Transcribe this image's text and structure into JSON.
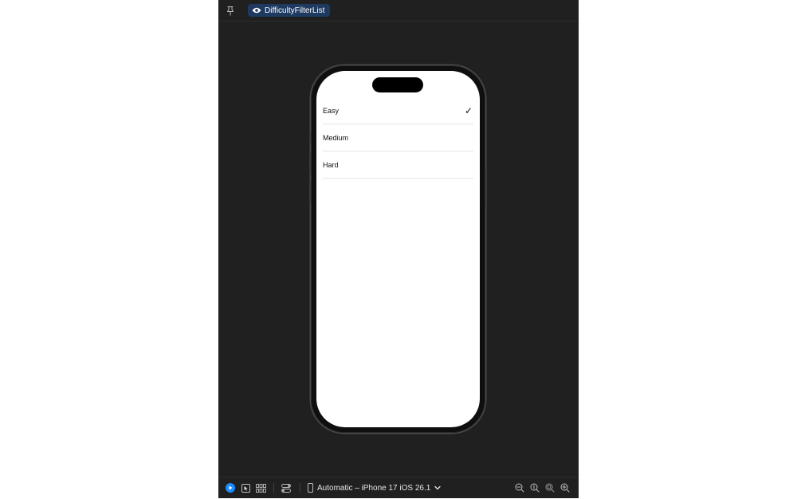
{
  "top_bar": {
    "preview_tab_label": "DifficultyFilterList"
  },
  "icons": {
    "pin": "pin-icon",
    "eye": "eye-icon",
    "play": "live-preview-icon",
    "select": "selectable-icon",
    "variants": "variants-grid-icon",
    "settings": "canvas-settings-icon",
    "device": "device-icon",
    "chevron": "chevron-down-icon",
    "zoom_out": "zoom-out-icon",
    "zoom_actual": "zoom-actual-icon",
    "zoom_fit": "zoom-fit-icon",
    "zoom_in": "zoom-in-icon"
  },
  "list": {
    "items": [
      {
        "label": "Easy",
        "checkmark": "✓"
      },
      {
        "label": "Medium"
      },
      {
        "label": "Hard"
      }
    ]
  },
  "bottom_bar": {
    "device_label": "Automatic – iPhone 17 iOS 26.1"
  },
  "colors": {
    "canvas": "#202020",
    "accent": "#1e8cff",
    "tab_bg": "#1e3a60"
  }
}
